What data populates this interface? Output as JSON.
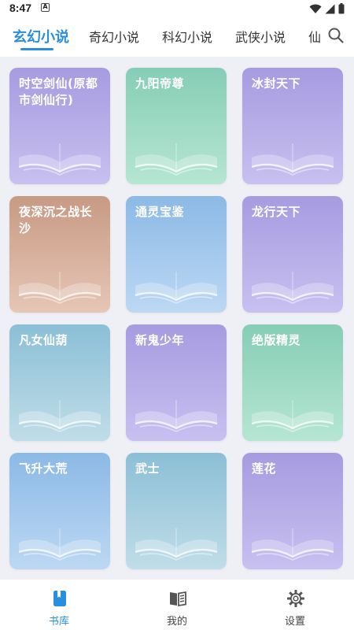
{
  "status_bar": {
    "time": "8:47",
    "app_badge": "A"
  },
  "tabs": [
    {
      "label": "玄幻小说",
      "active": true
    },
    {
      "label": "奇幻小说",
      "active": false
    },
    {
      "label": "科幻小说",
      "active": false
    },
    {
      "label": "武侠小说",
      "active": false
    },
    {
      "label": "仙",
      "active": false
    }
  ],
  "books": [
    {
      "title": "时空剑仙(原都市剑仙行)",
      "colors": [
        "#a79be0",
        "#c8c0f0"
      ]
    },
    {
      "title": "九阳帝尊",
      "colors": [
        "#86cdb5",
        "#b6e6d3"
      ]
    },
    {
      "title": "冰封天下",
      "colors": [
        "#a79be0",
        "#c8c0f0"
      ]
    },
    {
      "title": "夜深沉之战长沙",
      "colors": [
        "#c79a84",
        "#e6c6b6"
      ]
    },
    {
      "title": "通灵宝鉴",
      "colors": [
        "#8cb9e6",
        "#bcd8f3"
      ]
    },
    {
      "title": "龙行天下",
      "colors": [
        "#a79be0",
        "#c8c0f0"
      ]
    },
    {
      "title": "凡女仙葫",
      "colors": [
        "#8bbfd6",
        "#c0dde8"
      ]
    },
    {
      "title": "新鬼少年",
      "colors": [
        "#a79be0",
        "#c8c0f0"
      ]
    },
    {
      "title": "绝版精灵",
      "colors": [
        "#86cdb5",
        "#b6e6d3"
      ]
    },
    {
      "title": "飞升大荒",
      "colors": [
        "#8cb9e6",
        "#bcd8f3"
      ]
    },
    {
      "title": "武士",
      "colors": [
        "#8bbfd6",
        "#c0dde8"
      ]
    },
    {
      "title": "莲花",
      "colors": [
        "#a79be0",
        "#c8c0f0"
      ]
    }
  ],
  "bottom_nav": [
    {
      "label": "书库",
      "icon": "bookshelf-icon",
      "active": true
    },
    {
      "label": "我的",
      "icon": "open-book-icon",
      "active": false
    },
    {
      "label": "设置",
      "icon": "gear-icon",
      "active": false
    }
  ],
  "theme": {
    "accent": "#2a8ee0",
    "background": "#eef0f6"
  }
}
